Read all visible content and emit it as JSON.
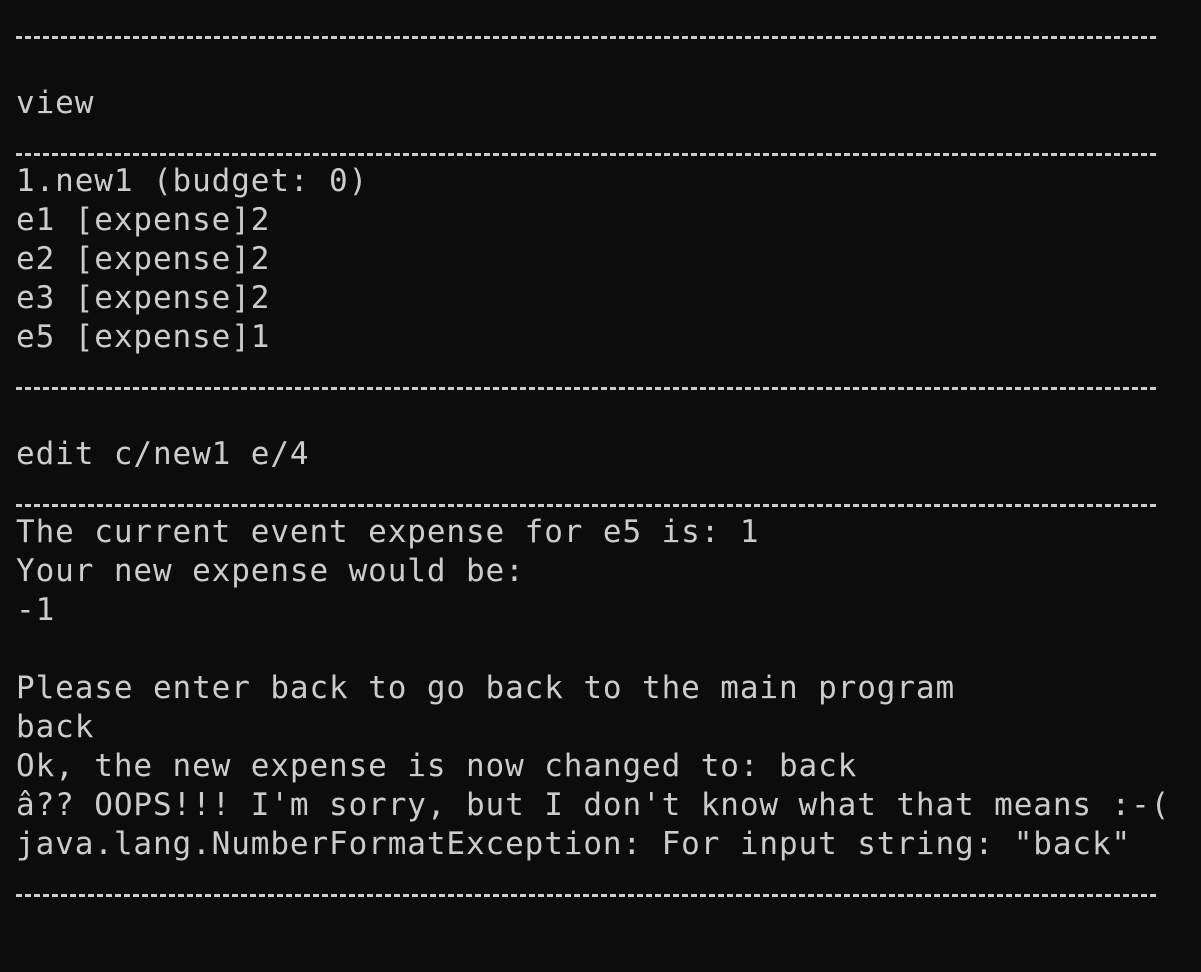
{
  "colors": {
    "background": "#0c0c0c",
    "foreground": "#cccccc"
  },
  "terminal": {
    "cmd_view": "view",
    "list_header": "1.new1 (budget: 0)",
    "list_rows": [
      "e1 [expense]2",
      "e2 [expense]2",
      "e3 [expense]2",
      "e5 [expense]1"
    ],
    "cmd_edit": "edit c/new1 e/4",
    "output": {
      "current": "The current event expense for e5 is: 1",
      "prompt_new": "Your new expense would be:",
      "new_value": "-1",
      "back_hint": "Please enter back to go back to the main program",
      "user_input": "back",
      "changed": "Ok, the new expense is now changed to: back",
      "error": "â?? OOPS!!! I'm sorry, but I don't know what that means :-(",
      "exception": "java.lang.NumberFormatException: For input string: \"back\""
    }
  }
}
